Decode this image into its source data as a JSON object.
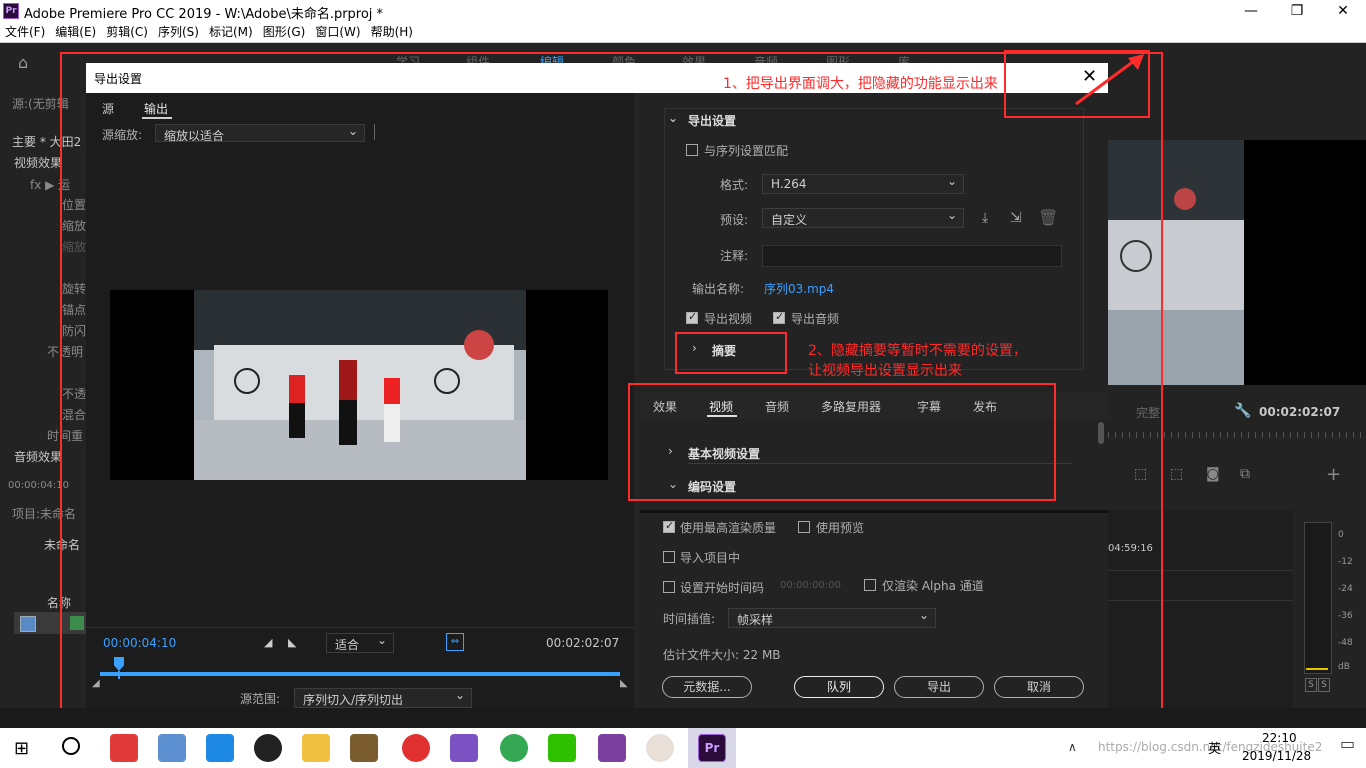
{
  "window": {
    "title": "Adobe Premiere Pro CC 2019 - W:\\Adobe\\未命名.prproj *",
    "app_badge": "Pr",
    "minimize": "—",
    "restore": "❐",
    "close": "✕"
  },
  "menu": [
    "文件(F)",
    "编辑(E)",
    "剪辑(C)",
    "序列(S)",
    "标记(M)",
    "图形(G)",
    "窗口(W)",
    "帮助(H)"
  ],
  "workspace_tabs": [
    "学习",
    "组件",
    "编辑",
    "颜色",
    "效果",
    "音频",
    "图形",
    "库"
  ],
  "left_panel": {
    "source_label": "源:(无剪辑",
    "main_label": "主要 * 大田2",
    "video_effects": "视频效果",
    "effects": [
      "fx ▶ 运",
      "位置",
      "缩放",
      "缩放",
      "旋转",
      "锚点",
      "防闪"
    ],
    "opacity": "不透明",
    "opacity_items": [
      "不透",
      "混合"
    ],
    "time_remap": "时间重",
    "audio_effects": "音频效果",
    "timecode": "00:00:04:10",
    "project": "项目:未命名",
    "project_file": "未命名",
    "name_col": "名称"
  },
  "dialog": {
    "title": "导出设置",
    "close": "✕",
    "tabs": {
      "source": "源",
      "output": "输出"
    },
    "source_scale_label": "源缩放:",
    "source_scale_value": "缩放以适合",
    "timecode_in": "00:00:04:10",
    "timecode_out": "00:02:02:07",
    "fit": "适合",
    "source_range_label": "源范围:",
    "source_range_value": "序列切入/序列切出",
    "export_settings": {
      "heading": "导出设置",
      "match_sequence": "与序列设置匹配",
      "format_label": "格式:",
      "format_value": "H.264",
      "preset_label": "预设:",
      "preset_value": "自定义",
      "comments_label": "注释:",
      "output_name_label": "输出名称:",
      "output_name_value": "序列03.mp4",
      "export_video": "导出视频",
      "export_audio": "导出音频",
      "summary": "摘要"
    },
    "tabs2": [
      "效果",
      "视频",
      "音频",
      "多路复用器",
      "字幕",
      "发布"
    ],
    "basic_video": "基本视频设置",
    "encoding": "编码设置",
    "use_max_quality": "使用最高渲染质量",
    "use_previews": "使用预览",
    "import_into_project": "导入项目中",
    "set_start_tc": "设置开始时间码",
    "start_tc_value": "00:00:00:00",
    "render_alpha": "仅渲染 Alpha 通道",
    "time_interp_label": "时间插值:",
    "time_interp_value": "帧采样",
    "est_size": "估计文件大小: 22 MB",
    "buttons": {
      "metadata": "元数据...",
      "queue": "队列",
      "export": "导出",
      "cancel": "取消"
    }
  },
  "right_monitor": {
    "fit": "完整",
    "timecode": "00:02:02:07",
    "time_ruler": "04:59:16",
    "meter_labels": [
      "0",
      "-12",
      "-24",
      "-36",
      "-48",
      "dB"
    ],
    "solo": [
      "S",
      "S"
    ]
  },
  "annotations": {
    "note1": "1、把导出界面调大，把隐藏的功能显示出来",
    "note2_line1": "2、隐藏摘要等暂时不需要的设置，",
    "note2_line2": "让视频导出设置显示出来"
  },
  "taskbar": {
    "time": "22:10",
    "date": "2019/11/28",
    "watermark": "https://blog.csdn.net/fengzideshuite2",
    "ime": "英"
  },
  "colors": {
    "accent_blue": "#3aa0ff",
    "annotation_red": "#ff2a2a",
    "panel_dark": "#232323"
  }
}
